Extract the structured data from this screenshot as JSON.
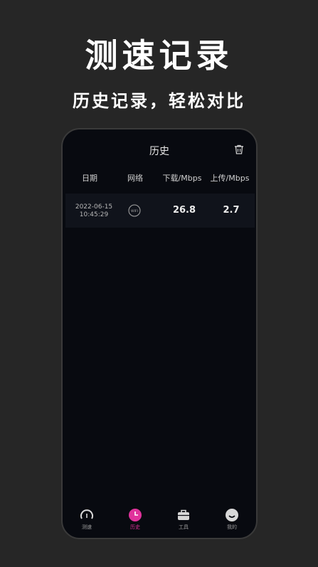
{
  "promo": {
    "headline": "测速记录",
    "subhead": "历史记录，轻松对比"
  },
  "header": {
    "title": "历史"
  },
  "table": {
    "columns": [
      "日期",
      "网络",
      "下载/Mbps",
      "上传/Mbps"
    ],
    "rows": [
      {
        "date": "2022-06-15",
        "time": "10:45:29",
        "network_icon": "wifi-icon",
        "network_label": "WIFI",
        "download": "26.8",
        "upload": "2.7"
      }
    ]
  },
  "tabs": [
    {
      "label": "测速",
      "icon": "speedometer-icon"
    },
    {
      "label": "历史",
      "icon": "clock-icon"
    },
    {
      "label": "工具",
      "icon": "toolbox-icon"
    },
    {
      "label": "我的",
      "icon": "smile-icon"
    }
  ],
  "colors": {
    "background": "#262626",
    "screen": "#080a10",
    "row": "#10131b",
    "accent": "#e0329c"
  }
}
